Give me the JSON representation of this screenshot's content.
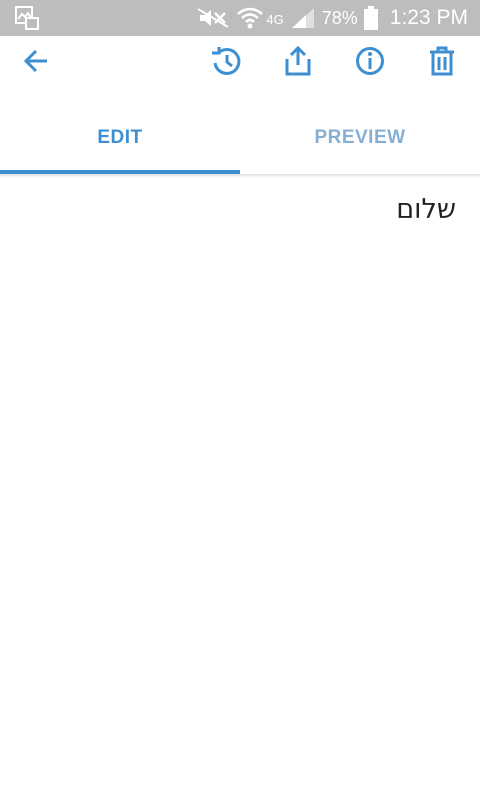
{
  "status_bar": {
    "battery": "78%",
    "time": "1:23 PM",
    "network": "4G",
    "icons": [
      "gallery-notification-icon",
      "mute-icon",
      "wifi-icon",
      "4g-icon",
      "signal-icon",
      "battery-icon"
    ]
  },
  "toolbar": {
    "icons": [
      "back-arrow-icon",
      "history-icon",
      "share-icon",
      "info-icon",
      "delete-icon"
    ],
    "accent_color": "#3d8fd1"
  },
  "tabs": [
    {
      "label": "EDIT",
      "active": true
    },
    {
      "label": "PREVIEW",
      "active": false
    }
  ],
  "editor": {
    "content": "שלום"
  }
}
